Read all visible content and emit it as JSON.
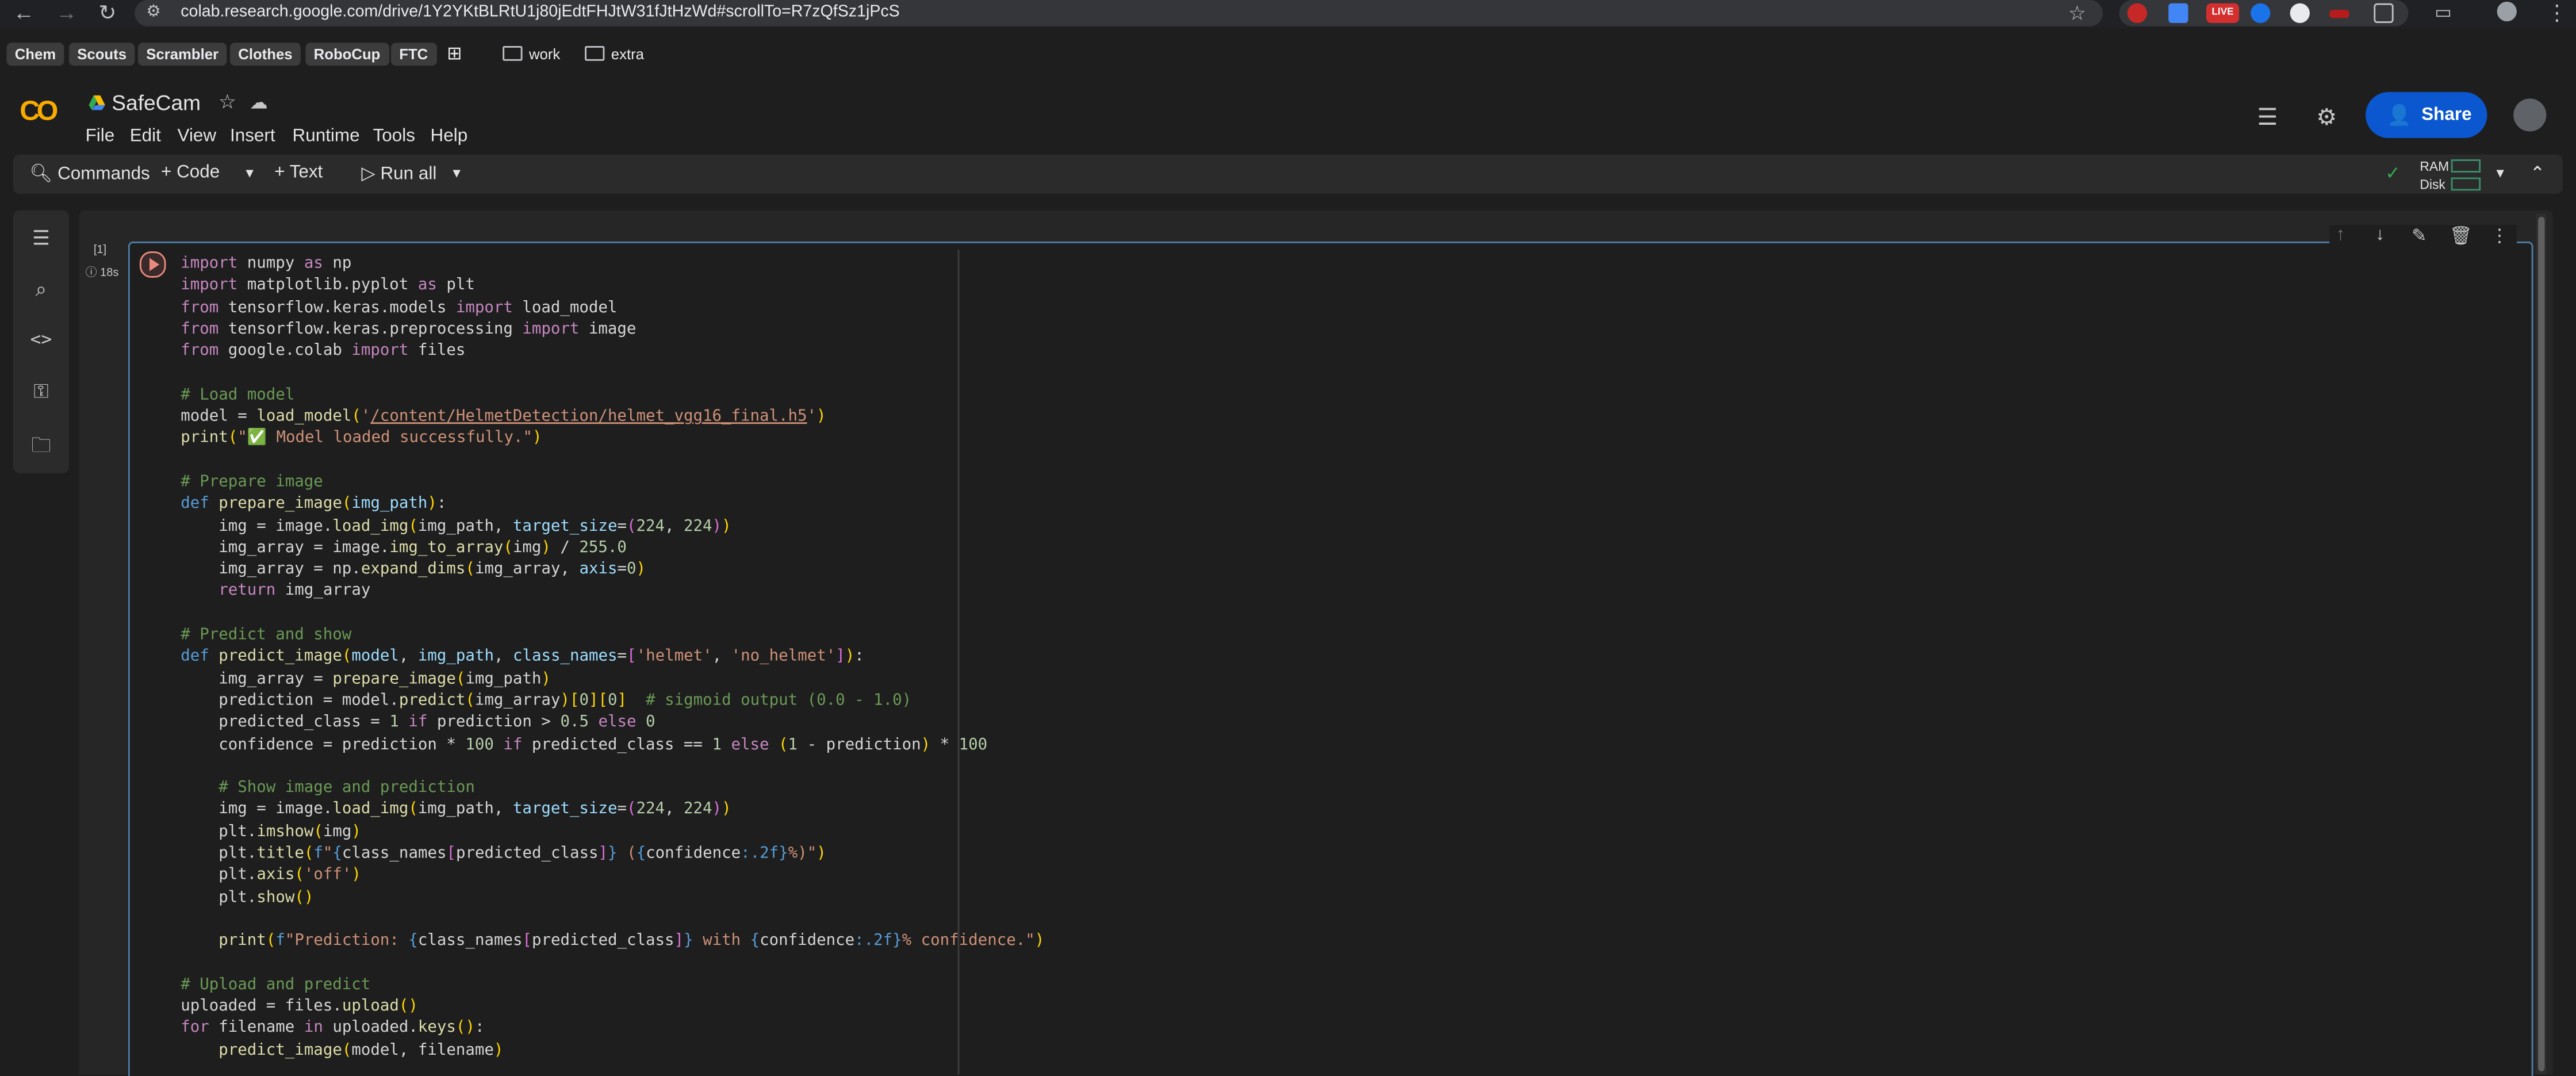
{
  "browser": {
    "url": "colab.research.google.com/drive/1Y2YKtBLRtU1j80jEdtFHJtW31fJtHzWd#scrollTo=R7zQfSz1jPcS",
    "extension_live_label": "LIVE",
    "bookmarks": [
      "Chem",
      "Scouts",
      "Scrambler",
      "Clothes",
      "RoboCup",
      "FTC"
    ],
    "folders": [
      "work",
      "extra"
    ]
  },
  "notebook": {
    "title": "SafeCam",
    "logo_text": "CO",
    "menu": [
      "File",
      "Edit",
      "View",
      "Insert",
      "Runtime",
      "Tools",
      "Help"
    ],
    "share_label": "Share"
  },
  "toolbar": {
    "commands_label": "Commands",
    "code_label": "+ Code",
    "text_label": "+ Text",
    "run_all_label": "Run all",
    "ram_label": "RAM",
    "disk_label": "Disk"
  },
  "cell": {
    "exec_count": "[1]",
    "exec_time": "18s"
  },
  "colors": {
    "accent": "#0b57d0",
    "logo": "#f9ab00",
    "cell_border": "#4e7ea6",
    "background": "#1e1e1e"
  },
  "icons": [
    "back-icon",
    "forward-icon",
    "reload-icon",
    "site-info-icon",
    "star-icon",
    "apps-icon",
    "toc-icon",
    "find-icon",
    "code-snippets-icon",
    "secrets-key-icon",
    "files-folder-icon",
    "comment-icon",
    "settings-gear-icon",
    "move-up-icon",
    "move-down-icon",
    "edit-icon",
    "delete-icon",
    "more-icon"
  ]
}
